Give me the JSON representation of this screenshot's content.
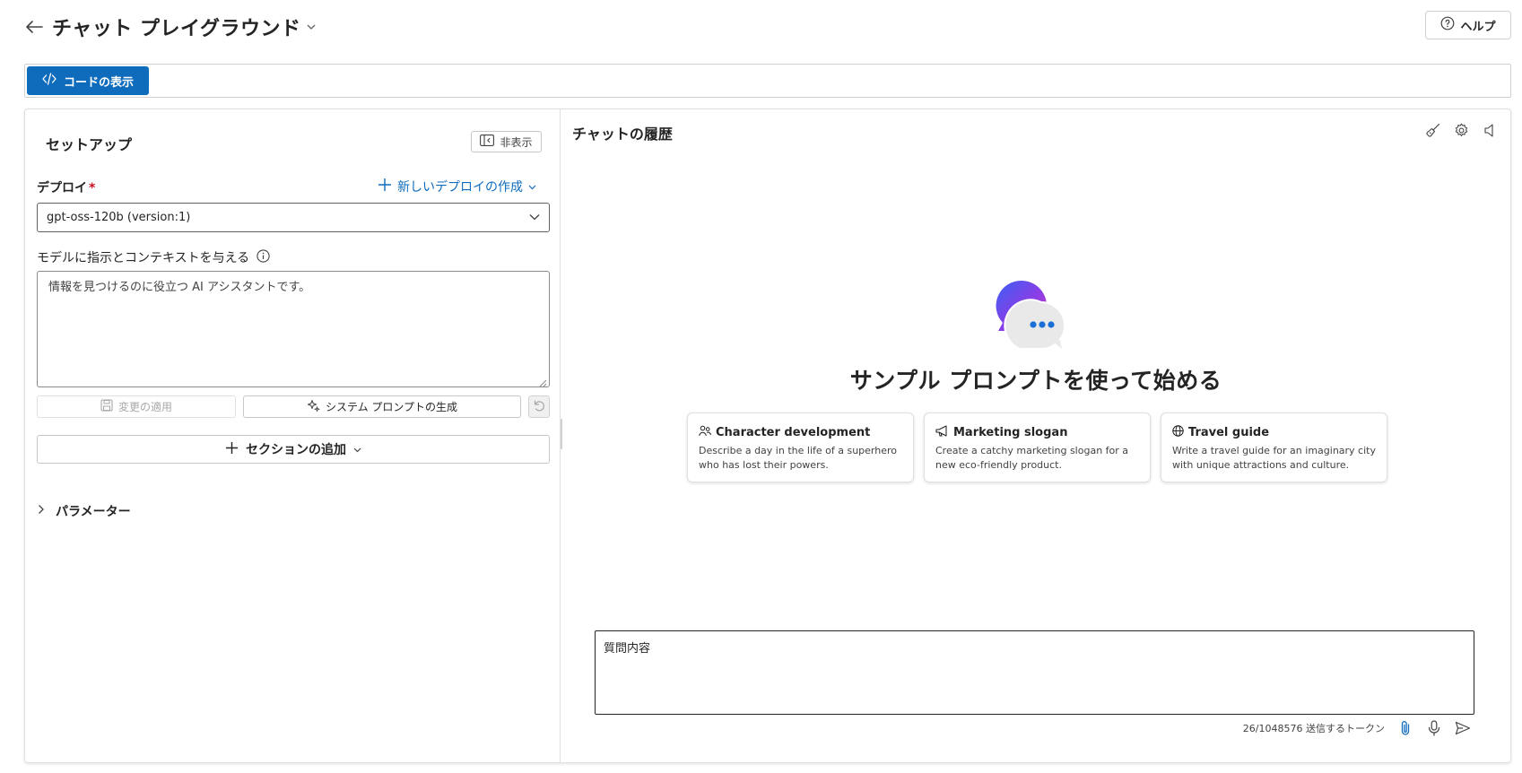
{
  "header": {
    "title": "チャット プレイグラウンド",
    "help_label": "ヘルプ"
  },
  "toolbar": {
    "view_code_label": "コードの表示"
  },
  "setup": {
    "title": "セットアップ",
    "hide_label": "非表示",
    "deploy_label": "デプロイ",
    "required_mark": "*",
    "new_deploy_label": "新しいデプロイの作成",
    "deploy_value": "gpt-oss-120b (version:1)",
    "instructions_label": "モデルに指示とコンテキストを与える",
    "instructions_value": "情報を見つけるのに役立つ AI アシスタントです。",
    "apply_label": "変更の適用",
    "generate_label": "システム プロンプトの生成",
    "add_section_label": "セクションの追加",
    "parameters_label": "パラメーター"
  },
  "chat": {
    "title": "チャットの履歴",
    "hero_title": "サンプル プロンプトを使って始める",
    "cards": [
      {
        "icon": "people-icon",
        "title": "Character development",
        "desc": "Describe a day in the life of a superhero who has lost their powers."
      },
      {
        "icon": "megaphone-icon",
        "title": "Marketing slogan",
        "desc": "Create a catchy marketing slogan for a new eco-friendly product."
      },
      {
        "icon": "globe-icon",
        "title": "Travel guide",
        "desc": "Write a travel guide for an imaginary city with unique attractions and culture."
      }
    ],
    "input_placeholder": "質問内容",
    "token_count": "26/1048576 送信するトークン"
  },
  "colors": {
    "accent": "#0f6cbd",
    "required": "#c50f1f"
  }
}
